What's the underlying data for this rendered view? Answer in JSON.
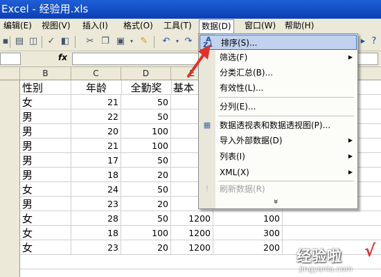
{
  "window": {
    "title": "Excel - 经验用.xls"
  },
  "menubar": {
    "items": [
      {
        "label": "编辑(E)"
      },
      {
        "label": "视图(V)"
      },
      {
        "label": "插入(I)"
      },
      {
        "label": "格式(O)"
      },
      {
        "label": "工具(T)"
      },
      {
        "label": "数据(D)"
      },
      {
        "label": "窗口(W)"
      },
      {
        "label": "帮助(H)"
      }
    ],
    "active": "数据(D)"
  },
  "formulabar": {
    "fx_label": "fx",
    "value": ""
  },
  "columns": [
    "B",
    "C",
    "D",
    "E"
  ],
  "rows": [
    {
      "gender": "性别",
      "age": "年龄",
      "bonus": "全勤奖",
      "base": "基本",
      "extra": ""
    },
    {
      "gender": "女",
      "age": "21",
      "bonus": "50",
      "base": "",
      "extra": ""
    },
    {
      "gender": "男",
      "age": "22",
      "bonus": "50",
      "base": "",
      "extra": ""
    },
    {
      "gender": "男",
      "age": "20",
      "bonus": "100",
      "base": "",
      "extra": ""
    },
    {
      "gender": "男",
      "age": "21",
      "bonus": "100",
      "base": "",
      "extra": ""
    },
    {
      "gender": "男",
      "age": "17",
      "bonus": "50",
      "base": "",
      "extra": ""
    },
    {
      "gender": "男",
      "age": "18",
      "bonus": "20",
      "base": "",
      "extra": ""
    },
    {
      "gender": "女",
      "age": "24",
      "bonus": "50",
      "base": "",
      "extra": ""
    },
    {
      "gender": "男",
      "age": "23",
      "bonus": "20",
      "base": "",
      "extra": ""
    },
    {
      "gender": "女",
      "age": "28",
      "bonus": "50",
      "base": "1200",
      "extra": "100"
    },
    {
      "gender": "女",
      "age": "18",
      "bonus": "100",
      "base": "1200",
      "extra": "300"
    },
    {
      "gender": "女",
      "age": "23",
      "bonus": "20",
      "base": "1200",
      "extra": "200"
    }
  ],
  "data_menu": {
    "items": [
      {
        "label": "排序(S)...",
        "icon": "sort-az-icon",
        "highlighted": true,
        "submenu": false,
        "disabled": false
      },
      {
        "label": "筛选(F)",
        "submenu": true,
        "disabled": false
      },
      {
        "label": "分类汇总(B)...",
        "submenu": false,
        "disabled": false
      },
      {
        "label": "有效性(L)...",
        "submenu": false,
        "disabled": false
      },
      {
        "label": "分列(E)...",
        "submenu": false,
        "disabled": false
      },
      {
        "label": "数据透视表和数据透视图(P)...",
        "icon": "pivot-table-icon",
        "submenu": false,
        "disabled": false
      },
      {
        "label": "导入外部数据(D)",
        "submenu": true,
        "disabled": false
      },
      {
        "label": "列表(I)",
        "submenu": true,
        "disabled": false
      },
      {
        "label": "XML(X)",
        "submenu": true,
        "disabled": false
      },
      {
        "label": "刷新数据(R)",
        "icon": "refresh-icon",
        "submenu": false,
        "disabled": true
      }
    ],
    "expand_glyph": "»"
  },
  "watermark": {
    "chinese": "经验啦",
    "check": "√",
    "url": "jingyanla.com"
  },
  "colors": {
    "titlebar": "#1f5fd6",
    "menubar": "#ece9d8",
    "highlight": "#c1d2ee",
    "annotation_arrow": "#e0302a"
  }
}
